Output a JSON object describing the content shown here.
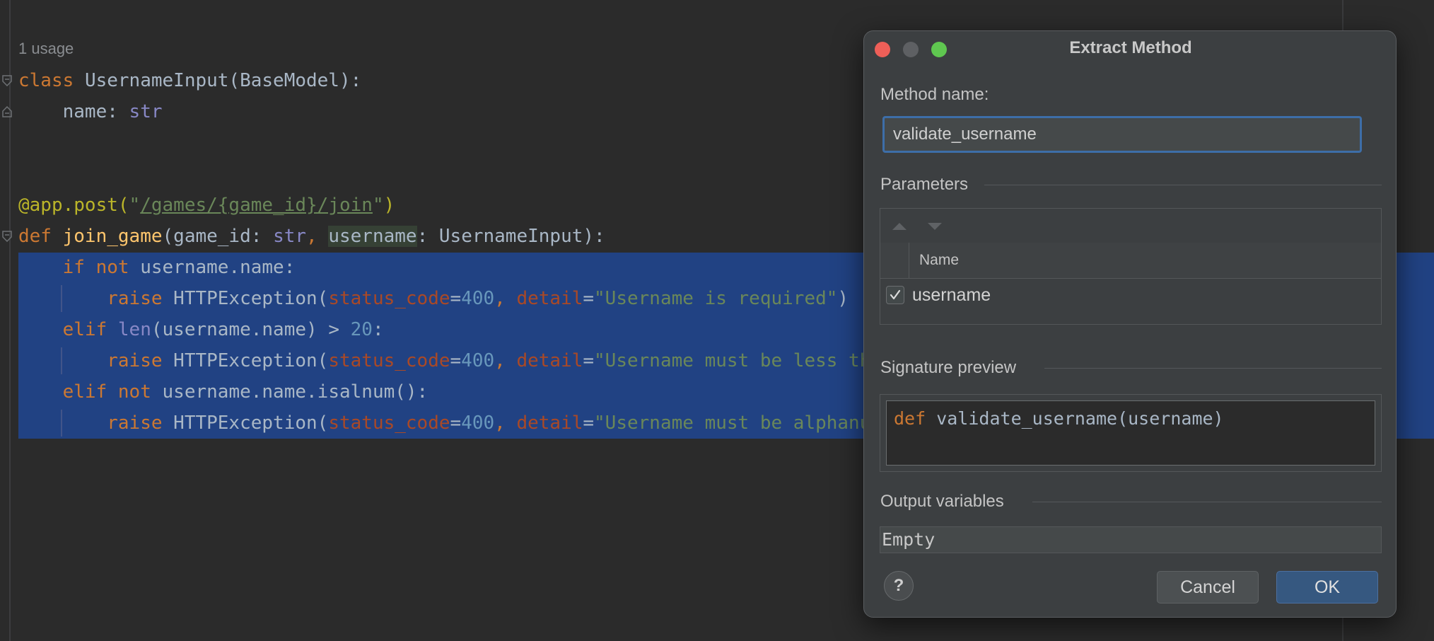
{
  "editor": {
    "usage_hint": "1 usage",
    "lines": {
      "l1": {
        "kw": "class",
        "name": "UsernameInput(BaseModel):"
      },
      "l2": {
        "field": "name: ",
        "type": "str"
      },
      "l3": {
        "dec": "@app.post(",
        "str_q1": "\"",
        "str_link": "/games/{game_id}/join",
        "str_q2": "\"",
        "close": ")"
      },
      "l4": {
        "kw": "def",
        "fn": "join_game",
        "p1": "(game_id: ",
        "t1": "str",
        "comma": ", ",
        "p2": "username",
        "p3": ": UsernameInput):"
      },
      "l5": {
        "kw1": "if",
        "kw2": "not",
        "rest": " username.name:"
      },
      "l6": {
        "kw": "raise",
        "exc": " HTTPException(",
        "arg1": "status_code",
        "eq1": "=",
        "n1": "400",
        "c1": ", ",
        "arg2": "detail",
        "eq2": "=",
        "s": "\"Username is required\"",
        "close": ")"
      },
      "l7": {
        "kw": "elif",
        "builtin": "len",
        "rest": "(username.name) > ",
        "num": "20",
        "colon": ":"
      },
      "l8": {
        "kw": "raise",
        "exc": " HTTPException(",
        "arg1": "status_code",
        "eq1": "=",
        "n1": "400",
        "c1": ", ",
        "arg2": "detail",
        "eq2": "=",
        "s": "\"Username must be less th"
      },
      "l9": {
        "kw1": "elif",
        "kw2": "not",
        "rest": " username.name.isalnum():"
      },
      "l10": {
        "kw": "raise",
        "exc": " HTTPException(",
        "arg1": "status_code",
        "eq1": "=",
        "n1": "400",
        "c1": ", ",
        "arg2": "detail",
        "eq2": "=",
        "s": "\"Username must be alphanu"
      }
    }
  },
  "dialog": {
    "title": "Extract Method",
    "method_name_label": "Method name:",
    "method_name_value": "validate_username",
    "parameters_label": "Parameters",
    "column_name": "Name",
    "parameters": [
      {
        "name": "username",
        "checked": true
      }
    ],
    "signature_label": "Signature preview",
    "signature_kw": "def",
    "signature_rest": " validate_username(username)",
    "output_label": "Output variables",
    "output_value": "Empty",
    "help_label": "?",
    "cancel_label": "Cancel",
    "ok_label": "OK"
  },
  "colors": {
    "selection": "#214283",
    "keyword": "#cc7832",
    "string": "#6a8759",
    "number": "#6897bb",
    "ok_button": "#365880"
  }
}
